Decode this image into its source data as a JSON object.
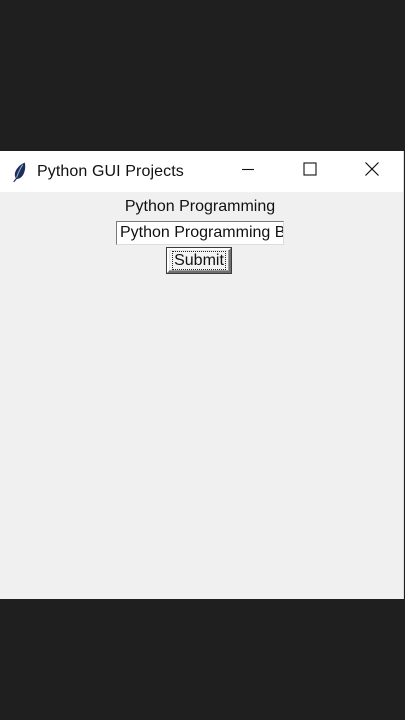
{
  "window": {
    "title": "Python GUI Projects"
  },
  "label": {
    "text": "Python Programming"
  },
  "entry": {
    "value": "Python Programming Basic Projects"
  },
  "button": {
    "label": "Submit"
  },
  "icons": {
    "app": "feather-icon",
    "minimize": "minimize-icon",
    "maximize": "maximize-icon",
    "close": "close-icon"
  }
}
